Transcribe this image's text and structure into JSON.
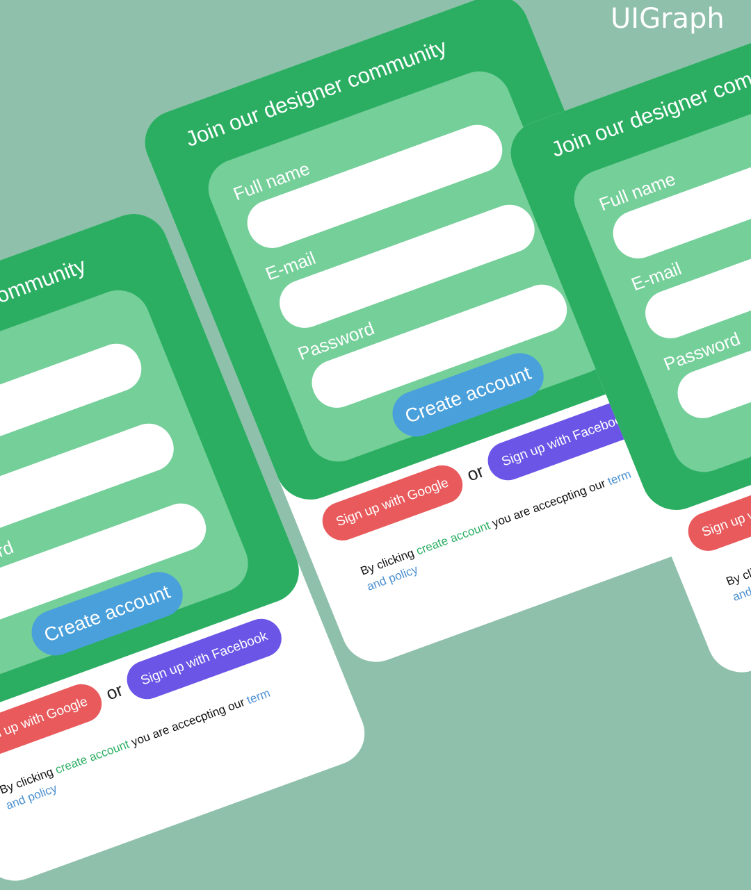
{
  "watermark": "UIGraph",
  "card": {
    "title": "Join our designer community",
    "fields": [
      {
        "label": "Full name",
        "value": ""
      },
      {
        "label": "E-mail",
        "value": ""
      },
      {
        "label": "Password",
        "value": ""
      }
    ],
    "create_button": "Create account",
    "google_button": "Sign up with Google",
    "or_text": "or",
    "facebook_button": "Sign up with Facebook",
    "terms": {
      "prefix": "By clicking ",
      "link": "create account",
      "middle": " you are accecpting our ",
      "policy": "term and policy"
    }
  },
  "colors": {
    "background": "#8fc0ab",
    "card_green": "#2bae62",
    "panel_green": "#74cf99",
    "create_blue": "#4aa0db",
    "google_red": "#e95a5c",
    "facebook_purple": "#6a55e6"
  }
}
